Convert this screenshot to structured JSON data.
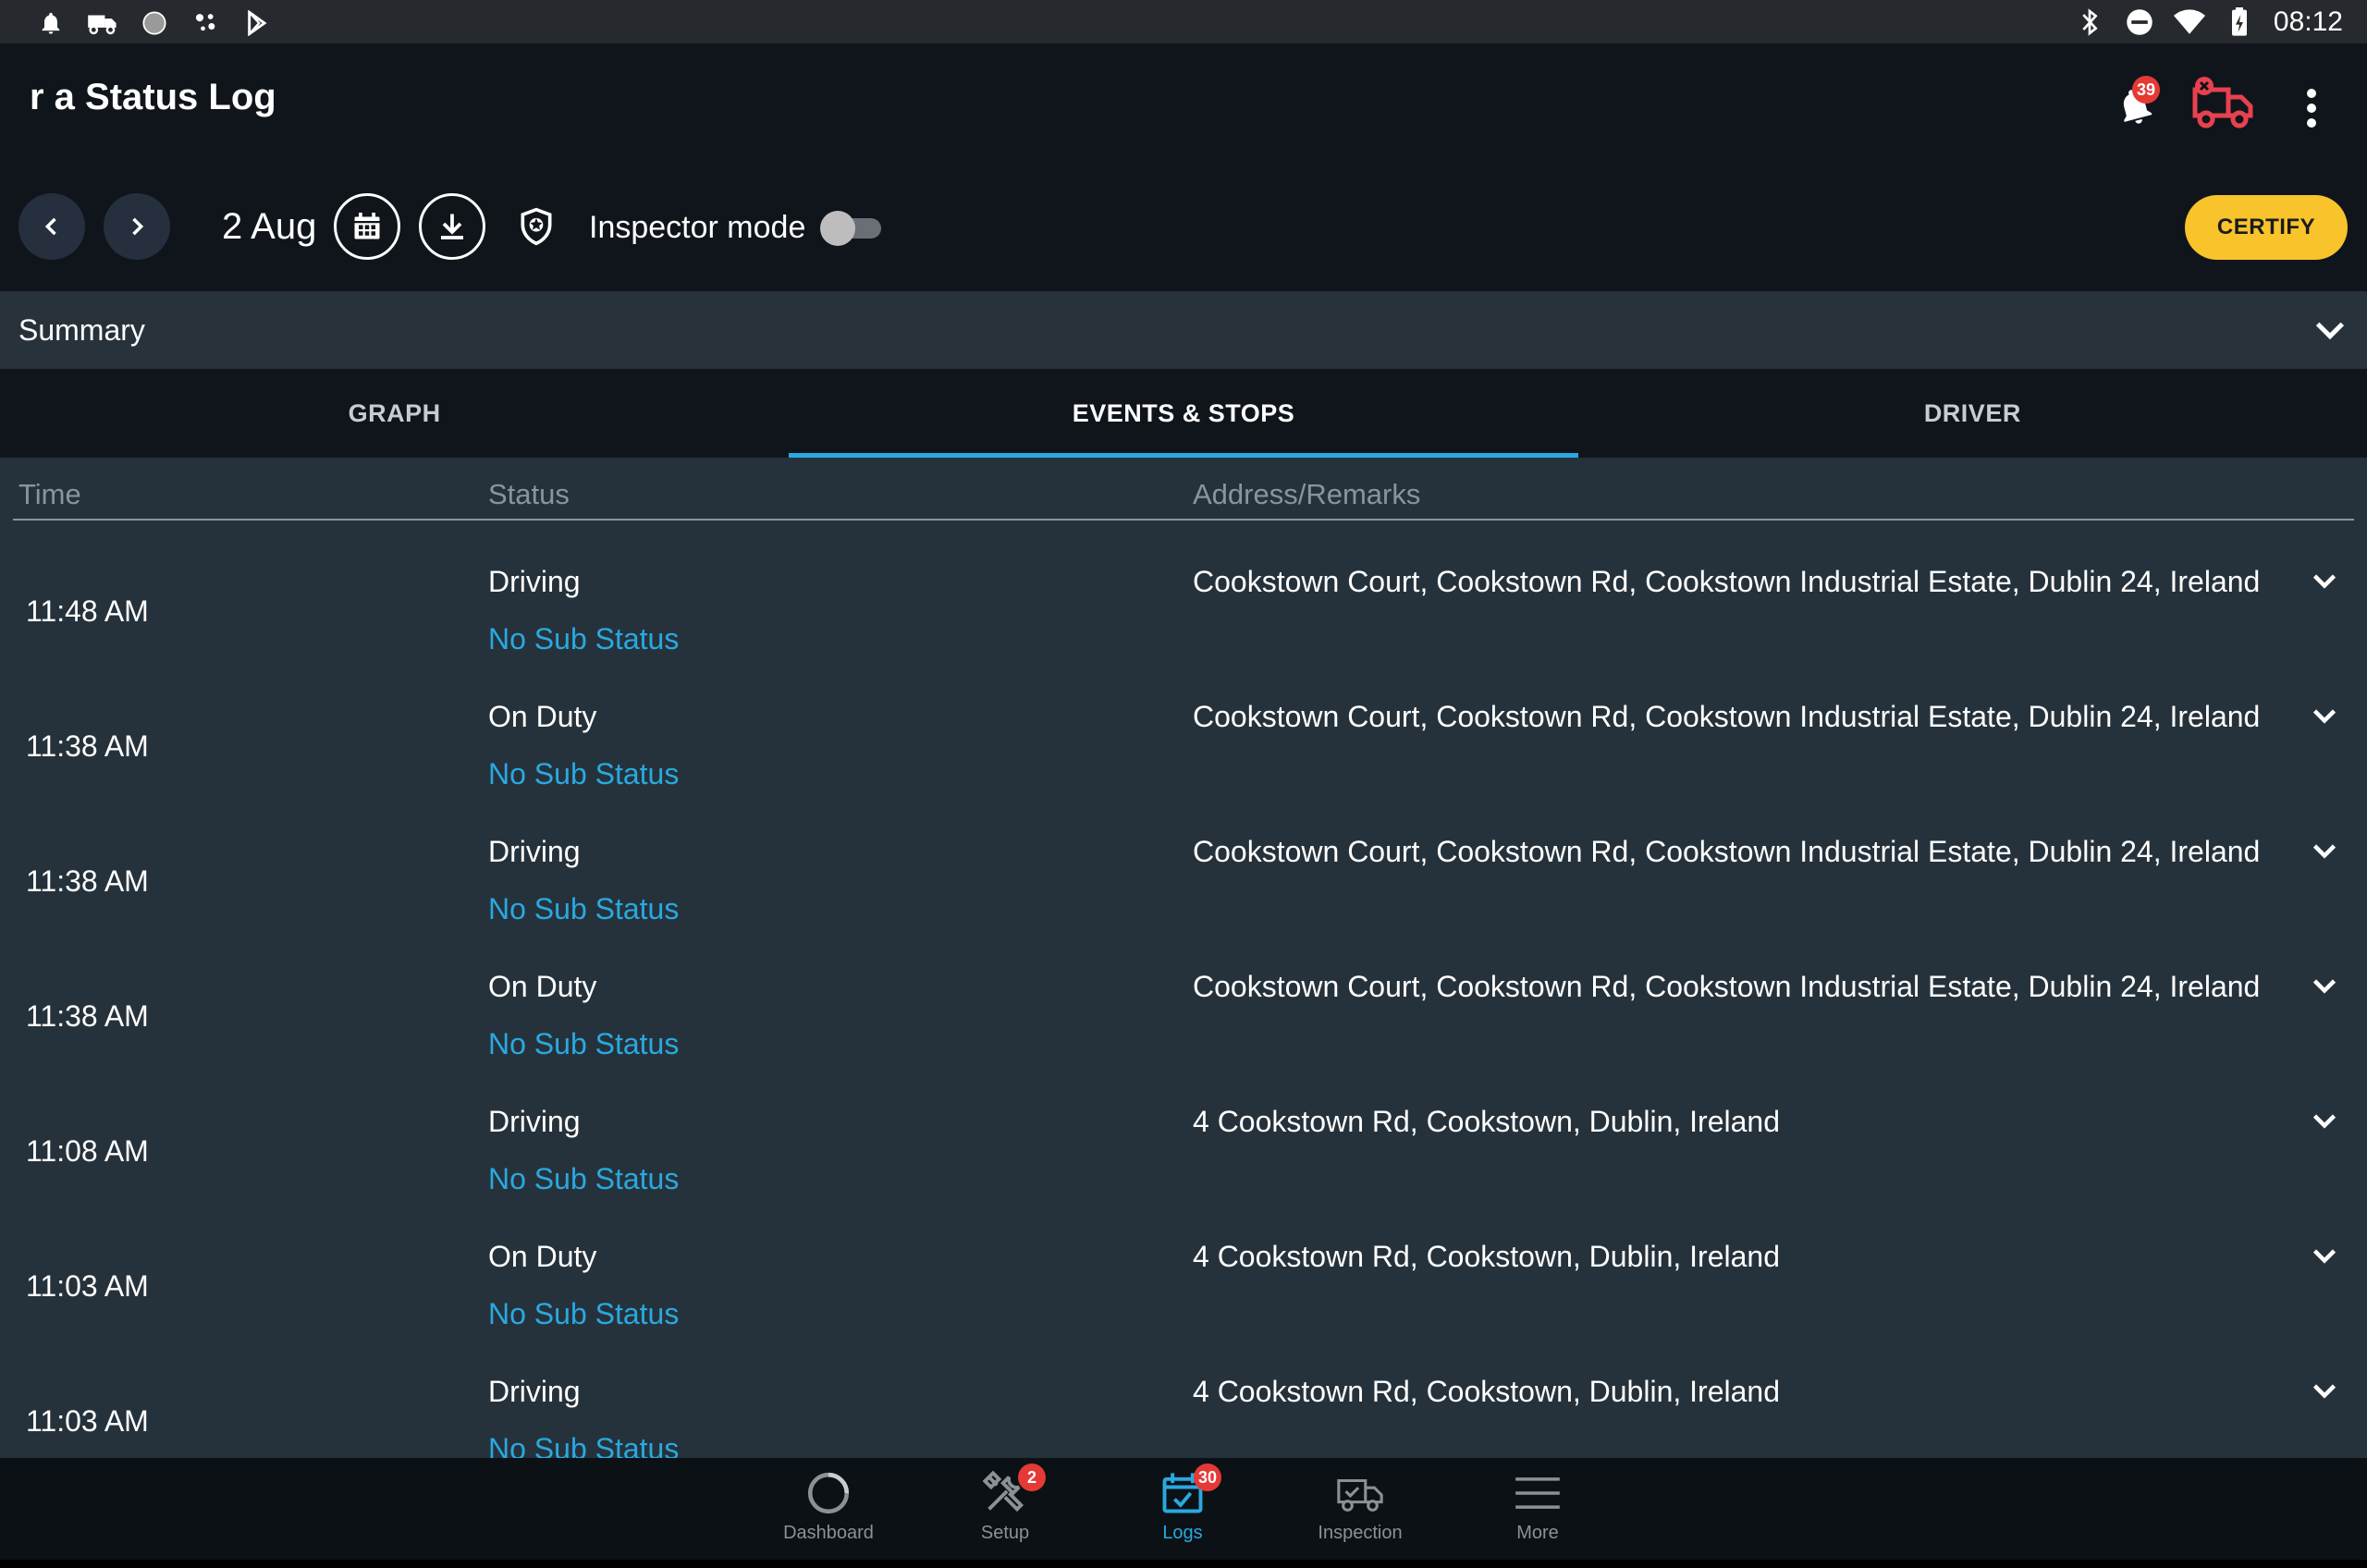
{
  "status_bar": {
    "time": "08:12",
    "left_icons": [
      "notification-bell-icon",
      "truck-icon",
      "circle-icon",
      "dots-icon",
      "play-store-icon"
    ],
    "right_icons": [
      "bluetooth-icon",
      "do-not-disturb-icon",
      "wifi-icon",
      "battery-icon"
    ]
  },
  "header": {
    "title": "r a Status Log",
    "notification_count": "39"
  },
  "toolbar": {
    "date": "2 Aug",
    "inspector_mode_label": "Inspector mode",
    "inspector_mode_on": false,
    "certify_label": "CERTIFY"
  },
  "summary": {
    "label": "Summary"
  },
  "tabs": [
    {
      "label": "GRAPH",
      "active": false
    },
    {
      "label": "EVENTS & STOPS",
      "active": true
    },
    {
      "label": "DRIVER",
      "active": false
    }
  ],
  "table": {
    "headers": {
      "time": "Time",
      "status": "Status",
      "address": "Address/Remarks"
    },
    "rows": [
      {
        "time": "11:48 AM",
        "status": "Driving",
        "sub_status": "No Sub Status",
        "address": "Cookstown Court, Cookstown Rd, Cookstown Industrial Estate, Dublin 24, Ireland"
      },
      {
        "time": "11:38 AM",
        "status": "On Duty",
        "sub_status": "No Sub Status",
        "address": "Cookstown Court, Cookstown Rd, Cookstown Industrial Estate, Dublin 24, Ireland"
      },
      {
        "time": "11:38 AM",
        "status": "Driving",
        "sub_status": "No Sub Status",
        "address": "Cookstown Court, Cookstown Rd, Cookstown Industrial Estate, Dublin 24, Ireland"
      },
      {
        "time": "11:38 AM",
        "status": "On Duty",
        "sub_status": "No Sub Status",
        "address": "Cookstown Court, Cookstown Rd, Cookstown Industrial Estate, Dublin 24, Ireland"
      },
      {
        "time": "11:08 AM",
        "status": "Driving",
        "sub_status": "No Sub Status",
        "address": "4 Cookstown Rd, Cookstown, Dublin, Ireland"
      },
      {
        "time": "11:03 AM",
        "status": "On Duty",
        "sub_status": "No Sub Status",
        "address": "4 Cookstown Rd, Cookstown, Dublin, Ireland"
      },
      {
        "time": "11:03 AM",
        "status": "Driving",
        "sub_status": "No Sub Status",
        "address": "4 Cookstown Rd, Cookstown, Dublin, Ireland"
      }
    ]
  },
  "bottom_nav": {
    "items": [
      {
        "label": "Dashboard",
        "icon": "dashboard-spinner-icon",
        "badge": ""
      },
      {
        "label": "Setup",
        "icon": "tools-icon",
        "badge": "2"
      },
      {
        "label": "Logs",
        "icon": "calendar-check-icon",
        "badge": "30"
      },
      {
        "label": "Inspection",
        "icon": "truck-check-icon",
        "badge": ""
      },
      {
        "label": "More",
        "icon": "menu-icon",
        "badge": ""
      }
    ]
  },
  "colors": {
    "accent": "#29a9e0",
    "certify": "#f8c32b",
    "badge": "#e53935",
    "alert_truck": "#e8414f"
  }
}
